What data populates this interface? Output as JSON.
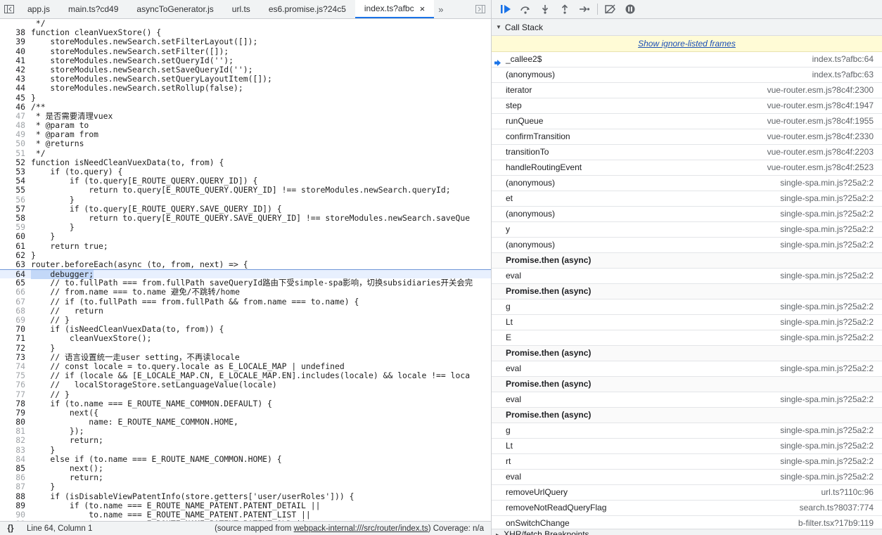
{
  "tabs": [
    {
      "label": "app.js",
      "active": false
    },
    {
      "label": "main.ts?cd49",
      "active": false
    },
    {
      "label": "asyncToGenerator.js",
      "active": false
    },
    {
      "label": "url.ts",
      "active": false
    },
    {
      "label": "es6.promise.js?24c5",
      "active": false
    },
    {
      "label": "index.ts?afbc",
      "active": true
    }
  ],
  "close_symbol": "×",
  "more_symbol": "»",
  "current_line": 64,
  "code_lines": [
    {
      "n": "",
      "t": " */",
      "dim": true
    },
    {
      "n": "38",
      "t": "function cleanVuexStore() {"
    },
    {
      "n": "39",
      "t": "    storeModules.newSearch.setFilterLayout([]);"
    },
    {
      "n": "40",
      "t": "    storeModules.newSearch.setFilter([]);"
    },
    {
      "n": "41",
      "t": "    storeModules.newSearch.setQueryId('');"
    },
    {
      "n": "42",
      "t": "    storeModules.newSearch.setSaveQueryId('');"
    },
    {
      "n": "43",
      "t": "    storeModules.newSearch.setQueryLayoutItem([]);"
    },
    {
      "n": "44",
      "t": "    storeModules.newSearch.setRollup(false);"
    },
    {
      "n": "45",
      "t": "}"
    },
    {
      "n": "46",
      "t": "/**",
      "c": true
    },
    {
      "n": "47",
      "t": " * 是否需要清理vuex",
      "c": true,
      "dim": true
    },
    {
      "n": "48",
      "t": " * @param to",
      "c": true,
      "dim": true
    },
    {
      "n": "49",
      "t": " * @param from",
      "c": true,
      "dim": true
    },
    {
      "n": "50",
      "t": " * @returns",
      "c": true,
      "dim": true
    },
    {
      "n": "51",
      "t": " */",
      "c": true,
      "dim": true
    },
    {
      "n": "52",
      "t": "function isNeedCleanVuexData(to, from) {"
    },
    {
      "n": "53",
      "t": "    if (to.query) {"
    },
    {
      "n": "54",
      "t": "        if (to.query[E_ROUTE_QUERY.QUERY_ID]) {"
    },
    {
      "n": "55",
      "t": "            return to.query[E_ROUTE_QUERY.QUERY_ID] !== storeModules.newSearch.queryId;"
    },
    {
      "n": "56",
      "t": "        }",
      "dim": true
    },
    {
      "n": "57",
      "t": "        if (to.query[E_ROUTE_QUERY.SAVE_QUERY_ID]) {"
    },
    {
      "n": "58",
      "t": "            return to.query[E_ROUTE_QUERY.SAVE_QUERY_ID] !== storeModules.newSearch.saveQue"
    },
    {
      "n": "59",
      "t": "        }",
      "dim": true
    },
    {
      "n": "60",
      "t": "    }"
    },
    {
      "n": "61",
      "t": "    return true;"
    },
    {
      "n": "62",
      "t": "}"
    },
    {
      "n": "63",
      "t": "router.beforeEach(async (to, from, next) => {"
    },
    {
      "n": "64",
      "t": "    debugger;"
    },
    {
      "n": "65",
      "t": "    // to.fullPath === from.fullPath saveQueryId路由下受simple-spa影响，切换subsidiaries开关会完",
      "c": true
    },
    {
      "n": "66",
      "t": "    // from.name === to.name 避免/不跳转/home",
      "c": true,
      "dim": true
    },
    {
      "n": "67",
      "t": "    // if (to.fullPath === from.fullPath && from.name === to.name) {",
      "c": true,
      "dim": true
    },
    {
      "n": "68",
      "t": "    //   return",
      "c": true,
      "dim": true
    },
    {
      "n": "69",
      "t": "    // }",
      "c": true,
      "dim": true
    },
    {
      "n": "70",
      "t": "    if (isNeedCleanVuexData(to, from)) {"
    },
    {
      "n": "71",
      "t": "        cleanVuexStore();"
    },
    {
      "n": "72",
      "t": "    }"
    },
    {
      "n": "73",
      "t": "    // 语言设置统一走user setting，不再读locale",
      "c": true
    },
    {
      "n": "74",
      "t": "    // const locale = to.query.locale as E_LOCALE_MAP | undefined",
      "c": true,
      "dim": true
    },
    {
      "n": "75",
      "t": "    // if (locale && [E_LOCALE_MAP.CN, E_LOCALE_MAP.EN].includes(locale) && locale !== loca",
      "c": true,
      "dim": true
    },
    {
      "n": "76",
      "t": "    //   localStorageStore.setLanguageValue(locale)",
      "c": true,
      "dim": true
    },
    {
      "n": "77",
      "t": "    // }",
      "c": true,
      "dim": true
    },
    {
      "n": "78",
      "t": "    if (to.name === E_ROUTE_NAME_COMMON.DEFAULT) {"
    },
    {
      "n": "79",
      "t": "        next({"
    },
    {
      "n": "80",
      "t": "            name: E_ROUTE_NAME_COMMON.HOME,"
    },
    {
      "n": "81",
      "t": "        });",
      "dim": true
    },
    {
      "n": "82",
      "t": "        return;",
      "dim": true
    },
    {
      "n": "83",
      "t": "    }",
      "dim": true
    },
    {
      "n": "84",
      "t": "    else if (to.name === E_ROUTE_NAME_COMMON.HOME) {",
      "dim": true
    },
    {
      "n": "85",
      "t": "        next();"
    },
    {
      "n": "86",
      "t": "        return;",
      "dim": true
    },
    {
      "n": "87",
      "t": "    }",
      "dim": true
    },
    {
      "n": "88",
      "t": "    if (isDisableViewPatentInfo(store.getters['user/userRoles'])) {"
    },
    {
      "n": "89",
      "t": "        if (to.name === E_ROUTE_NAME_PATENT.PATENT_DETAIL ||"
    },
    {
      "n": "90",
      "t": "            to.name === E_ROUTE_NAME_PATENT.PATENT_LIST ||",
      "dim": true
    },
    {
      "n": "91",
      "t": "            to.name === E_ROUTE_NAME_PATENT.PATENT_OLD ||",
      "dim": true
    }
  ],
  "status": {
    "braces": "{}",
    "position": "Line 64, Column 1",
    "mapped_prefix": "(source mapped from ",
    "mapped_link": "webpack-internal:///src/router/index.ts",
    "mapped_suffix": ")",
    "coverage": "Coverage: n/a"
  },
  "call_stack": {
    "title": "Call Stack",
    "ignore_link": "Show ignore-listed frames",
    "frames": [
      {
        "fn": "_callee2$",
        "loc": "index.ts?afbc:64",
        "selected": true
      },
      {
        "fn": "(anonymous)",
        "loc": "index.ts?afbc:63"
      },
      {
        "fn": "iterator",
        "loc": "vue-router.esm.js?8c4f:2300"
      },
      {
        "fn": "step",
        "loc": "vue-router.esm.js?8c4f:1947"
      },
      {
        "fn": "runQueue",
        "loc": "vue-router.esm.js?8c4f:1955"
      },
      {
        "fn": "confirmTransition",
        "loc": "vue-router.esm.js?8c4f:2330"
      },
      {
        "fn": "transitionTo",
        "loc": "vue-router.esm.js?8c4f:2203"
      },
      {
        "fn": "handleRoutingEvent",
        "loc": "vue-router.esm.js?8c4f:2523"
      },
      {
        "fn": "(anonymous)",
        "loc": "single-spa.min.js?25a2:2"
      },
      {
        "fn": "et",
        "loc": "single-spa.min.js?25a2:2"
      },
      {
        "fn": "(anonymous)",
        "loc": "single-spa.min.js?25a2:2"
      },
      {
        "fn": "y",
        "loc": "single-spa.min.js?25a2:2"
      },
      {
        "fn": "(anonymous)",
        "loc": "single-spa.min.js?25a2:2"
      },
      {
        "fn": "Promise.then (async)",
        "loc": "",
        "async": true
      },
      {
        "fn": "eval",
        "loc": "single-spa.min.js?25a2:2"
      },
      {
        "fn": "Promise.then (async)",
        "loc": "",
        "async": true
      },
      {
        "fn": "g",
        "loc": "single-spa.min.js?25a2:2"
      },
      {
        "fn": "Lt",
        "loc": "single-spa.min.js?25a2:2"
      },
      {
        "fn": "E",
        "loc": "single-spa.min.js?25a2:2"
      },
      {
        "fn": "Promise.then (async)",
        "loc": "",
        "async": true
      },
      {
        "fn": "eval",
        "loc": "single-spa.min.js?25a2:2"
      },
      {
        "fn": "Promise.then (async)",
        "loc": "",
        "async": true
      },
      {
        "fn": "eval",
        "loc": "single-spa.min.js?25a2:2"
      },
      {
        "fn": "Promise.then (async)",
        "loc": "",
        "async": true
      },
      {
        "fn": "g",
        "loc": "single-spa.min.js?25a2:2"
      },
      {
        "fn": "Lt",
        "loc": "single-spa.min.js?25a2:2"
      },
      {
        "fn": "rt",
        "loc": "single-spa.min.js?25a2:2"
      },
      {
        "fn": "eval",
        "loc": "single-spa.min.js?25a2:2"
      },
      {
        "fn": "removeUrlQuery",
        "loc": "url.ts?110c:96"
      },
      {
        "fn": "removeNotReadQueryFlag",
        "loc": "search.ts?8037:774"
      },
      {
        "fn": "onSwitchChange",
        "loc": "b-filter.tsx?17b9:119"
      }
    ]
  },
  "xhr_section": "XHR/fetch Breakpoints",
  "colors": {
    "accent": "#1a73e8",
    "comment": "#2a7a2a",
    "banner": "#fffbd6"
  }
}
